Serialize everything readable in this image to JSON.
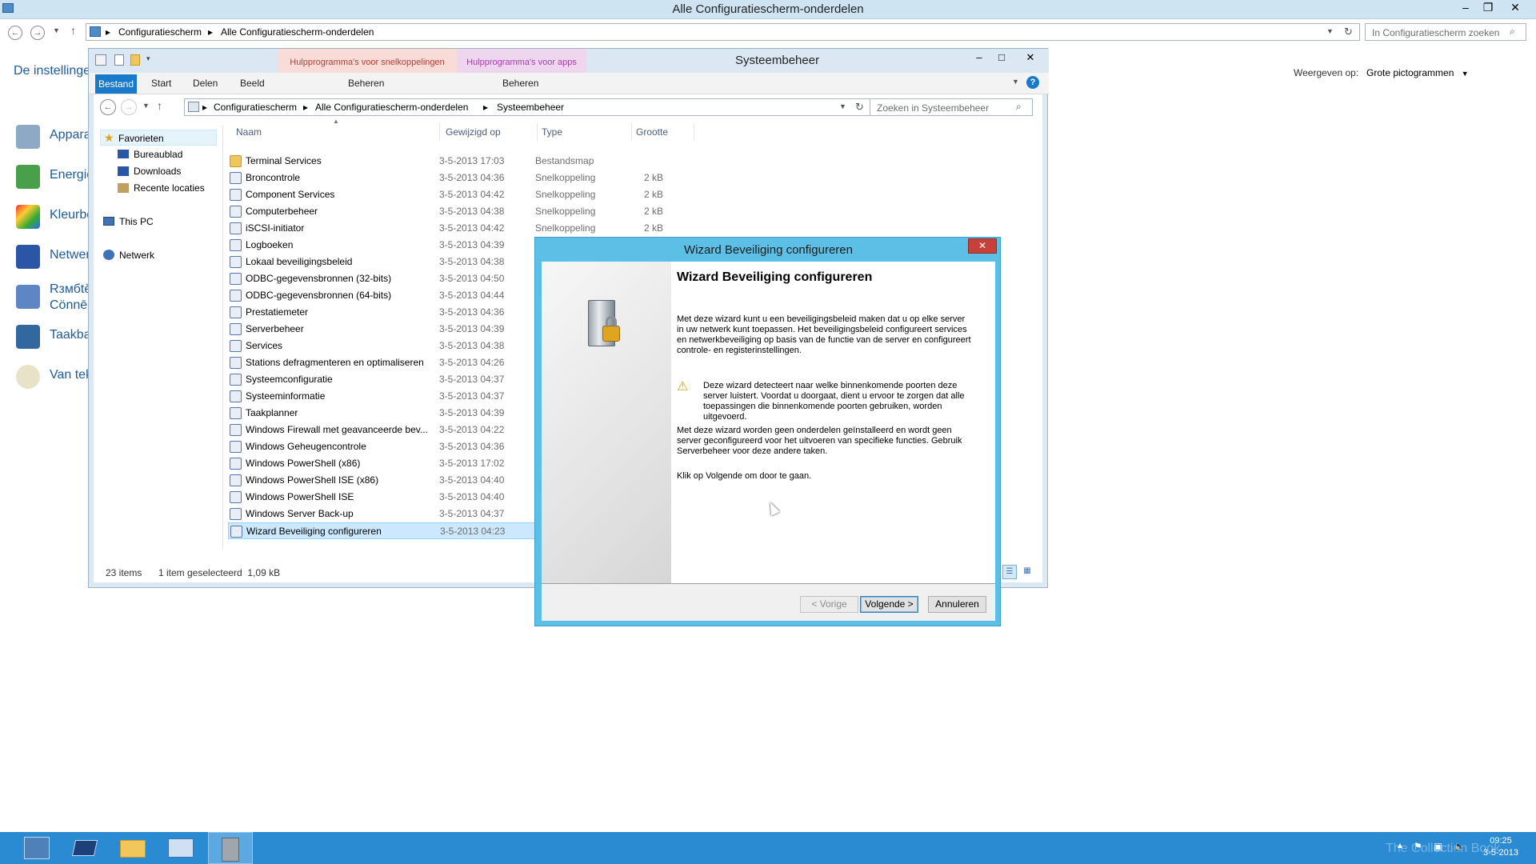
{
  "main_window": {
    "title": "Alle Configuratiescherm-onderdelen",
    "breadcrumb": [
      "Configuratiescherm",
      "Alle Configuratiescherm-onderdelen"
    ],
    "search_placeholder": "In Configuratiescherm zoeken",
    "view_label": "Weergeven op:",
    "view_value": "Grote pictogrammen",
    "left_heading": "De instellinge",
    "left_items": [
      "Appara",
      "Energie",
      "Kleurbe",
      "Netwer",
      "Rзмбtě\nCönnē",
      "Taakba",
      "Van tek"
    ]
  },
  "explorer": {
    "title": "Systeembeheer",
    "context_tab1": "Hulpprogramma's voor snelkoppelingen",
    "context_tab2": "Hulpprogramma's voor apps",
    "context_sub1": "Beheren",
    "context_sub2": "Beheren",
    "tabs": [
      "Bestand",
      "Start",
      "Delen",
      "Beeld"
    ],
    "breadcrumb": [
      "Configuratiescherm",
      "Alle Configuratiescherm-onderdelen",
      "Systeembeheer"
    ],
    "search_placeholder": "Zoeken in Systeembeheer",
    "nav": {
      "favorites": "Favorieten",
      "fav_items": [
        "Bureaublad",
        "Downloads",
        "Recente locaties"
      ],
      "this_pc": "This PC",
      "network": "Netwerk"
    },
    "columns": [
      "Naam",
      "Gewijzigd op",
      "Type",
      "Grootte"
    ],
    "files": [
      {
        "name": "Terminal Services",
        "date": "3-5-2013 17:03",
        "type": "Bestandsmap",
        "size": "",
        "icon": "folder-icon"
      },
      {
        "name": "Broncontrole",
        "date": "3-5-2013 04:36",
        "type": "Snelkoppeling",
        "size": "2 kB",
        "icon": "shortcut-icon"
      },
      {
        "name": "Component Services",
        "date": "3-5-2013 04:42",
        "type": "Snelkoppeling",
        "size": "2 kB",
        "icon": "shortcut-icon"
      },
      {
        "name": "Computerbeheer",
        "date": "3-5-2013 04:38",
        "type": "Snelkoppeling",
        "size": "2 kB",
        "icon": "shortcut-icon"
      },
      {
        "name": "iSCSI-initiator",
        "date": "3-5-2013 04:42",
        "type": "Snelkoppeling",
        "size": "2 kB",
        "icon": "shortcut-icon"
      },
      {
        "name": "Logboeken",
        "date": "3-5-2013 04:39",
        "type": "",
        "size": "",
        "icon": "shortcut-icon"
      },
      {
        "name": "Lokaal beveiligingsbeleid",
        "date": "3-5-2013 04:38",
        "type": "",
        "size": "",
        "icon": "shortcut-icon"
      },
      {
        "name": "ODBC-gegevensbronnen (32-bits)",
        "date": "3-5-2013 04:50",
        "type": "",
        "size": "",
        "icon": "shortcut-icon"
      },
      {
        "name": "ODBC-gegevensbronnen (64-bits)",
        "date": "3-5-2013 04:44",
        "type": "",
        "size": "",
        "icon": "shortcut-icon"
      },
      {
        "name": "Prestatiemeter",
        "date": "3-5-2013 04:36",
        "type": "",
        "size": "",
        "icon": "shortcut-icon"
      },
      {
        "name": "Serverbeheer",
        "date": "3-5-2013 04:39",
        "type": "",
        "size": "",
        "icon": "shortcut-icon"
      },
      {
        "name": "Services",
        "date": "3-5-2013 04:38",
        "type": "",
        "size": "",
        "icon": "shortcut-icon"
      },
      {
        "name": "Stations defragmenteren en optimaliseren",
        "date": "3-5-2013 04:26",
        "type": "",
        "size": "",
        "icon": "shortcut-icon"
      },
      {
        "name": "Systeemconfiguratie",
        "date": "3-5-2013 04:37",
        "type": "",
        "size": "",
        "icon": "shortcut-icon"
      },
      {
        "name": "Systeeminformatie",
        "date": "3-5-2013 04:37",
        "type": "",
        "size": "",
        "icon": "shortcut-icon"
      },
      {
        "name": "Taakplanner",
        "date": "3-5-2013 04:39",
        "type": "",
        "size": "",
        "icon": "shortcut-icon"
      },
      {
        "name": "Windows Firewall met geavanceerde bev...",
        "date": "3-5-2013 04:22",
        "type": "",
        "size": "",
        "icon": "shortcut-icon"
      },
      {
        "name": "Windows Geheugencontrole",
        "date": "3-5-2013 04:36",
        "type": "",
        "size": "",
        "icon": "shortcut-icon"
      },
      {
        "name": "Windows PowerShell (x86)",
        "date": "3-5-2013 17:02",
        "type": "",
        "size": "",
        "icon": "shortcut-icon"
      },
      {
        "name": "Windows PowerShell ISE (x86)",
        "date": "3-5-2013 04:40",
        "type": "",
        "size": "",
        "icon": "shortcut-icon"
      },
      {
        "name": "Windows PowerShell ISE",
        "date": "3-5-2013 04:40",
        "type": "",
        "size": "",
        "icon": "shortcut-icon"
      },
      {
        "name": "Windows Server Back-up",
        "date": "3-5-2013 04:37",
        "type": "",
        "size": "",
        "icon": "shortcut-icon"
      },
      {
        "name": "Wizard Beveiliging configureren",
        "date": "3-5-2013 04:23",
        "type": "",
        "size": "",
        "icon": "shortcut-icon",
        "selected": true
      }
    ],
    "status_items": "23 items",
    "status_selected": "1 item geselecteerd  1,09 kB"
  },
  "dialog": {
    "title": "Wizard Beveiliging configureren",
    "heading": "Wizard Beveiliging configureren",
    "para1": "Met deze wizard kunt u een beveiligingsbeleid maken dat u op elke server in uw netwerk kunt toepassen. Het beveiligingsbeleid configureert services en netwerkbeveiliging op basis van de functie van de server en configureert controle- en registerinstellingen.",
    "warning": "Deze wizard detecteert naar welke binnenkomende poorten deze server luistert. Voordat u doorgaat, dient u ervoor te zorgen dat alle toepassingen die binnenkomende poorten gebruiken, worden uitgevoerd.",
    "para2": "Met deze wizard worden geen onderdelen geïnstalleerd en wordt geen server geconfigureerd voor het uitvoeren van specifieke functies. Gebruik Serverbeheer voor deze andere taken.",
    "para3": "Klik op Volgende om door te gaan.",
    "btn_back": "< Vorige",
    "btn_next": "Volgende >",
    "btn_cancel": "Annuleren"
  },
  "taskbar": {
    "time": "09:25",
    "date": "3-5-2013",
    "watermark": "The Collection Book"
  },
  "colors": {
    "accent": "#1979ca",
    "taskbar": "#2a8bd3",
    "dialog_frame": "#5cc0e6",
    "selection": "#cce8ff"
  }
}
